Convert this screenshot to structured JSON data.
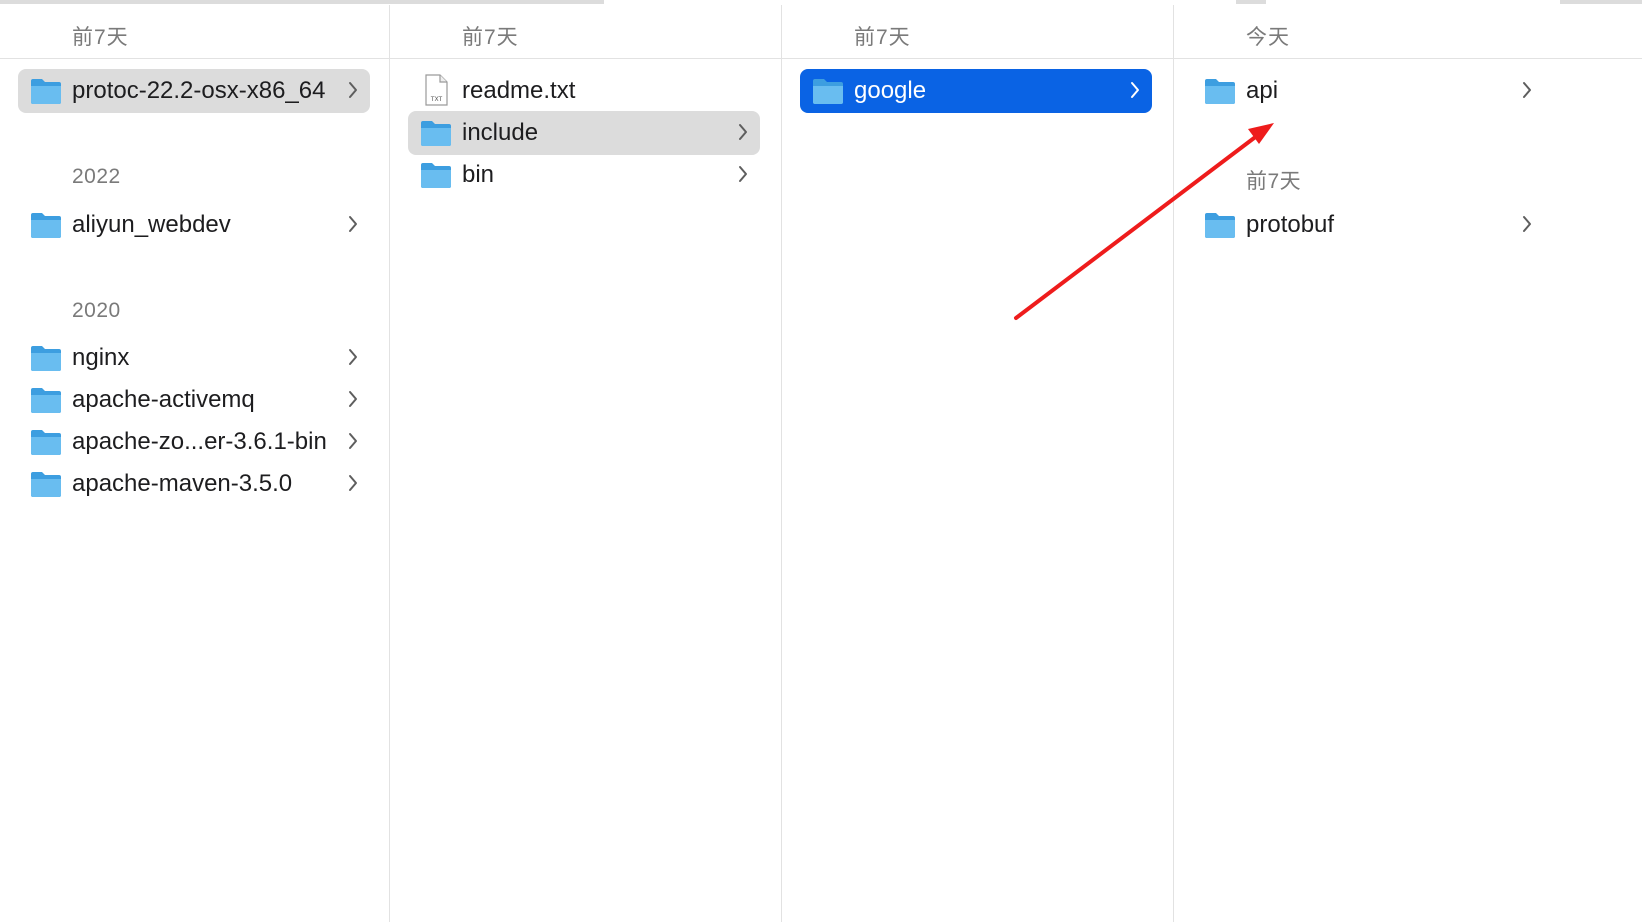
{
  "columns": [
    {
      "header": "前7天",
      "groups": [
        {
          "header": "",
          "items": [
            {
              "name": "protoc-22.2-osx-x86_64",
              "kind": "folder",
              "state": "path-selected"
            }
          ]
        },
        {
          "header": "2022",
          "items": [
            {
              "name": "aliyun_webdev",
              "kind": "folder",
              "state": "normal"
            }
          ]
        },
        {
          "header": "2020",
          "items": [
            {
              "name": "nginx",
              "kind": "folder",
              "state": "normal"
            },
            {
              "name": "apache-activemq",
              "kind": "folder",
              "state": "normal"
            },
            {
              "name": "apache-zo...er-3.6.1-bin",
              "kind": "folder",
              "state": "normal"
            },
            {
              "name": "apache-maven-3.5.0",
              "kind": "folder",
              "state": "normal"
            }
          ]
        }
      ]
    },
    {
      "header": "前7天",
      "groups": [
        {
          "header": "",
          "items": [
            {
              "name": "readme.txt",
              "kind": "file",
              "state": "normal"
            },
            {
              "name": "include",
              "kind": "folder",
              "state": "path-selected"
            },
            {
              "name": "bin",
              "kind": "folder",
              "state": "normal"
            }
          ]
        }
      ]
    },
    {
      "header": "前7天",
      "groups": [
        {
          "header": "",
          "items": [
            {
              "name": "google",
              "kind": "folder",
              "state": "active-selected"
            }
          ]
        }
      ]
    },
    {
      "header": "今天",
      "groups": [
        {
          "header": "",
          "items": [
            {
              "name": "api",
              "kind": "folder",
              "state": "normal"
            }
          ]
        },
        {
          "header": "前7天",
          "items": [
            {
              "name": "protobuf",
              "kind": "folder",
              "state": "normal"
            }
          ]
        }
      ]
    }
  ],
  "file_badge": "TXT",
  "colors": {
    "selection_active": "#0a63e4",
    "selection_path": "#dcdcdc",
    "folder_blue": "#5fb4ec",
    "annotation_arrow": "#ee1c1c"
  },
  "icons": {
    "folder": "folder-icon",
    "file": "text-file-icon",
    "chevron": "chevron-right-icon",
    "annotation": "red-arrow-annotation"
  }
}
